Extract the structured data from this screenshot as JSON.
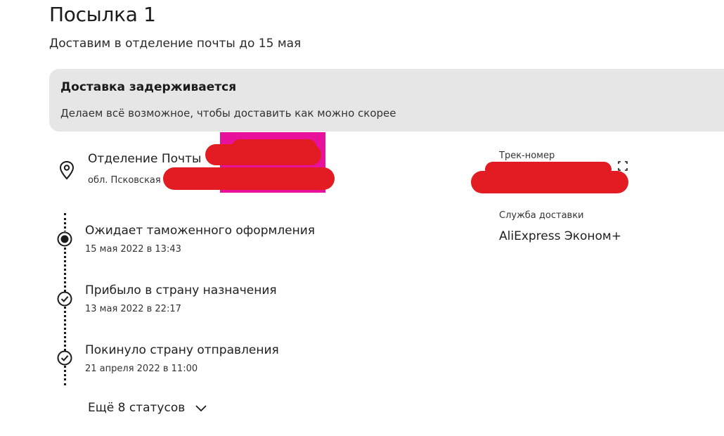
{
  "parcel": {
    "title": "Посылка 1",
    "delivery_estimate": "Доставим в отделение почты до 15 мая"
  },
  "notice": {
    "title": "Доставка задерживается",
    "text": "Делаем всё возможное, чтобы доставить как можно скорее"
  },
  "destination": {
    "icon": "location-pin-icon",
    "name": "Отделение Почты",
    "address": "обл. Псковская"
  },
  "statuses": [
    {
      "title": "Ожидает таможенного оформления",
      "date": "15 мая 2022 в 13:43",
      "icon": "current-status-dot-icon"
    },
    {
      "title": "Прибыло в страну назначения",
      "date": "13 мая 2022 в 22:17",
      "icon": "check-circle-icon"
    },
    {
      "title": "Покинуло страну отправления",
      "date": "21 апреля 2022 в 11:00",
      "icon": "check-circle-icon"
    }
  ],
  "more_statuses": {
    "label": "Ещё 8 статусов",
    "icon": "chevron-down-icon"
  },
  "tracking": {
    "label": "Трек-номер",
    "copy_icon": "copy-icon"
  },
  "carrier": {
    "label": "Служба доставки",
    "value": "AliExpress Эконом+"
  },
  "colors": {
    "notice_bg": "#e6e6e6",
    "redaction_red": "#e31b23",
    "redaction_pink": "#e8119b"
  }
}
